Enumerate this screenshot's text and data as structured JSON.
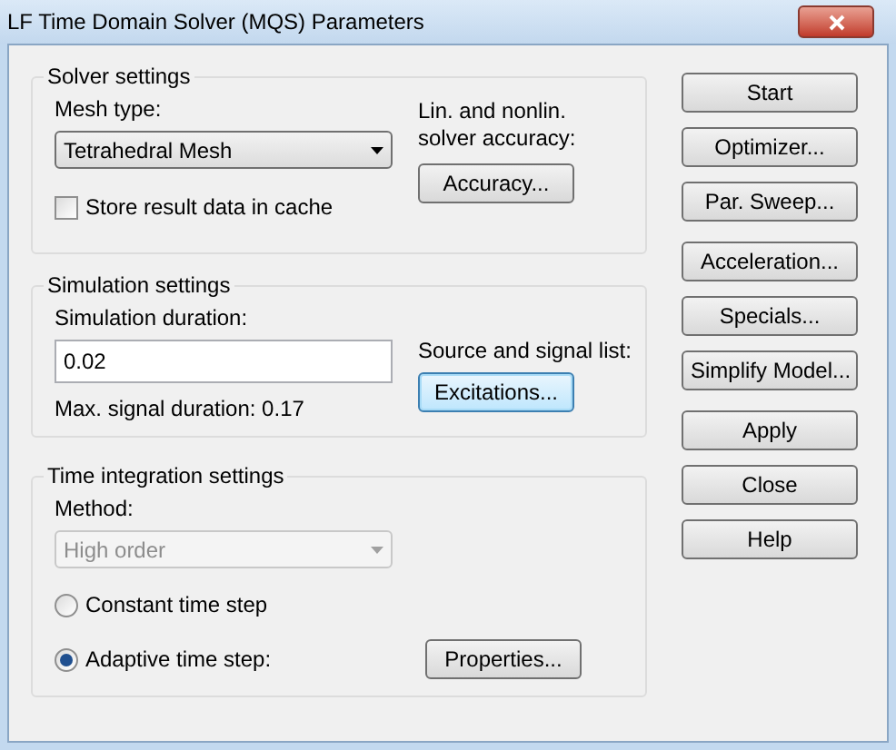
{
  "window": {
    "title": "LF Time Domain Solver (MQS) Parameters"
  },
  "solver_settings": {
    "title": "Solver settings",
    "mesh_type_label": "Mesh type:",
    "mesh_type": {
      "value": "Tetrahedral Mesh",
      "disabled": false
    },
    "store_cache": {
      "label": "Store result data in cache",
      "checked": false
    },
    "accuracy_label": "Lin. and nonlin. solver accuracy:",
    "accuracy_button": {
      "label": "Accuracy...",
      "focused": false
    }
  },
  "simulation_settings": {
    "title": "Simulation settings",
    "duration_label": "Simulation duration:",
    "duration_value": "0.02",
    "max_signal": "Max. signal duration: 0.17",
    "source_label": "Source and signal list:",
    "excitations_button": {
      "label": "Excitations...",
      "focused": true
    }
  },
  "time_integration": {
    "title": "Time integration settings",
    "method_label": "Method:",
    "method": {
      "value": "High order",
      "disabled": true
    },
    "options": [
      {
        "label": "Constant time step",
        "selected": false
      },
      {
        "label": "Adaptive time step:",
        "selected": true
      }
    ],
    "properties_button": {
      "label": "Properties...",
      "focused": false
    }
  },
  "button_groups": [
    [
      {
        "label": "Start"
      },
      {
        "label": "Optimizer..."
      },
      {
        "label": "Par. Sweep..."
      }
    ],
    [
      {
        "label": "Acceleration..."
      },
      {
        "label": "Specials..."
      },
      {
        "label": "Simplify Model..."
      }
    ],
    [
      {
        "label": "Apply"
      },
      {
        "label": "Close"
      },
      {
        "label": "Help"
      }
    ]
  ]
}
